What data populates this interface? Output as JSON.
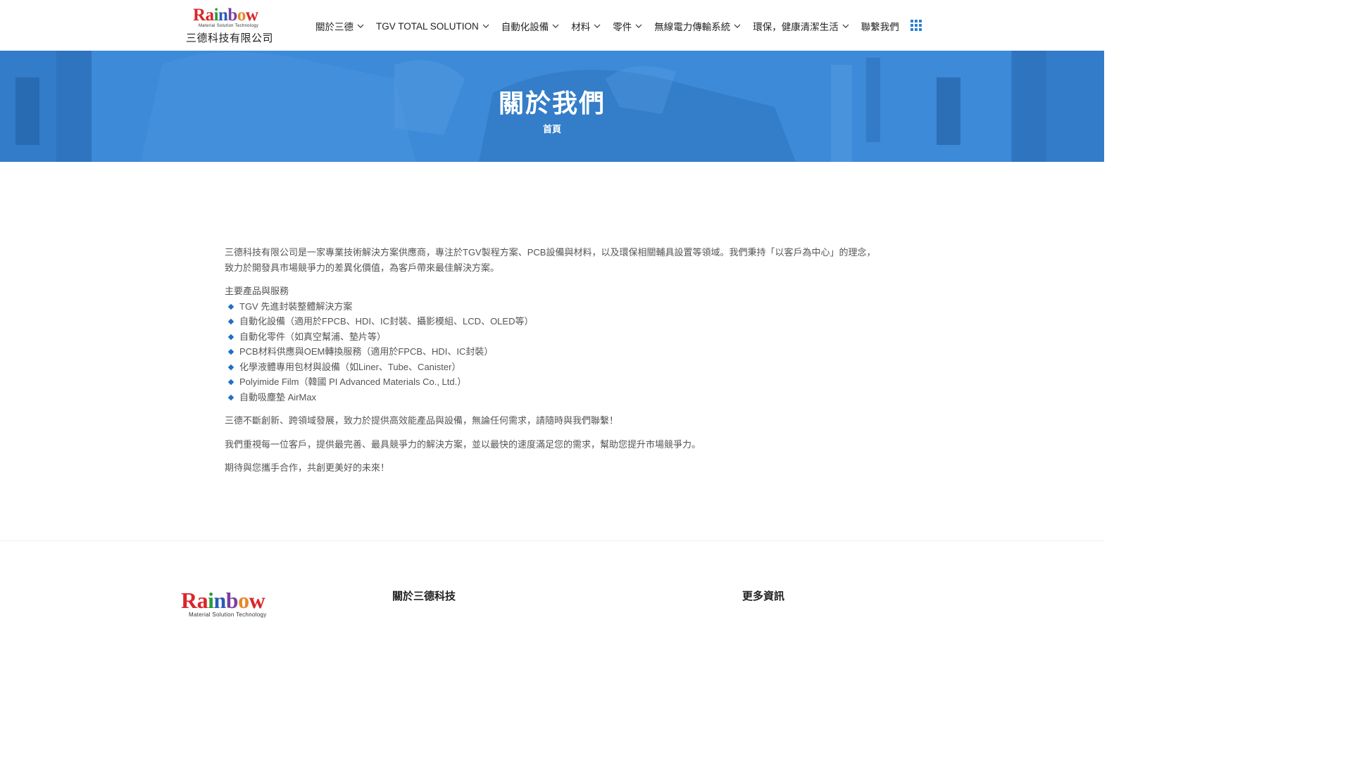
{
  "brand": {
    "logo_letters": [
      "R",
      "a",
      "i",
      "n",
      "b",
      "o",
      "w"
    ],
    "logo_colors": [
      "#d9262b",
      "#d9262b",
      "#2a9a3c",
      "#2b5bb5",
      "#7b3fa0",
      "#e8872a",
      "#d9262b"
    ],
    "tagline": "Material Solution Technology",
    "company": "三德科技有限公司"
  },
  "nav": {
    "items": [
      {
        "label": "關於三德",
        "dropdown": true
      },
      {
        "label": "TGV TOTAL SOLUTION",
        "dropdown": true
      },
      {
        "label": "自動化設備",
        "dropdown": true
      },
      {
        "label": "材料",
        "dropdown": true
      },
      {
        "label": "零件",
        "dropdown": true
      },
      {
        "label": "無線電力傳輸系統",
        "dropdown": true
      },
      {
        "label": "環保，健康清潔生活",
        "dropdown": true
      },
      {
        "label": "聯繫我們",
        "dropdown": false
      }
    ],
    "apps_icon": "grid-icon"
  },
  "hero": {
    "title": "關於我們",
    "breadcrumb": "首頁",
    "overlay_color": "#3b89d8"
  },
  "content": {
    "intro": "三德科技有限公司是一家專業技術解決方案供應商，專注於TGV製程方案、PCB設備與材料，以及環保相關輔具設置等領域。我們秉持「以客戶為中心」的理念，致力於開發具市場競爭力的差異化價值，為客戶帶來最佳解決方案。",
    "services_heading": "主要產品與服務",
    "services": [
      "TGV 先進封裝整體解決方案",
      "自動化設備（適用於FPCB、HDI、IC封裝、攝影模組、LCD、OLED等）",
      "自動化零件（如真空幫浦、墊片等）",
      "PCB材料供應與OEM轉換服務（適用於FPCB、HDI、IC封裝）",
      "化學液體專用包材與設備（如Liner、Tube、Canister）",
      "Polyimide Film（韓國 PI Advanced Materials Co., Ltd.）",
      "自動吸塵墊 AirMax"
    ],
    "para1": "三德不斷創新、跨領域發展，致力於提供高效能產品與設備，無論任何需求，請隨時與我們聯繫！",
    "para2": "我們重視每一位客戶，提供最完善、最具競爭力的解決方案，並以最快的速度滿足您的需求，幫助您提升市場競爭力。",
    "para3": "期待與您攜手合作，共創更美好的未來！"
  },
  "footer": {
    "logo_tagline": "Material Solution Technology",
    "about_heading": "關於三德科技",
    "more_heading": "更多資訊"
  }
}
